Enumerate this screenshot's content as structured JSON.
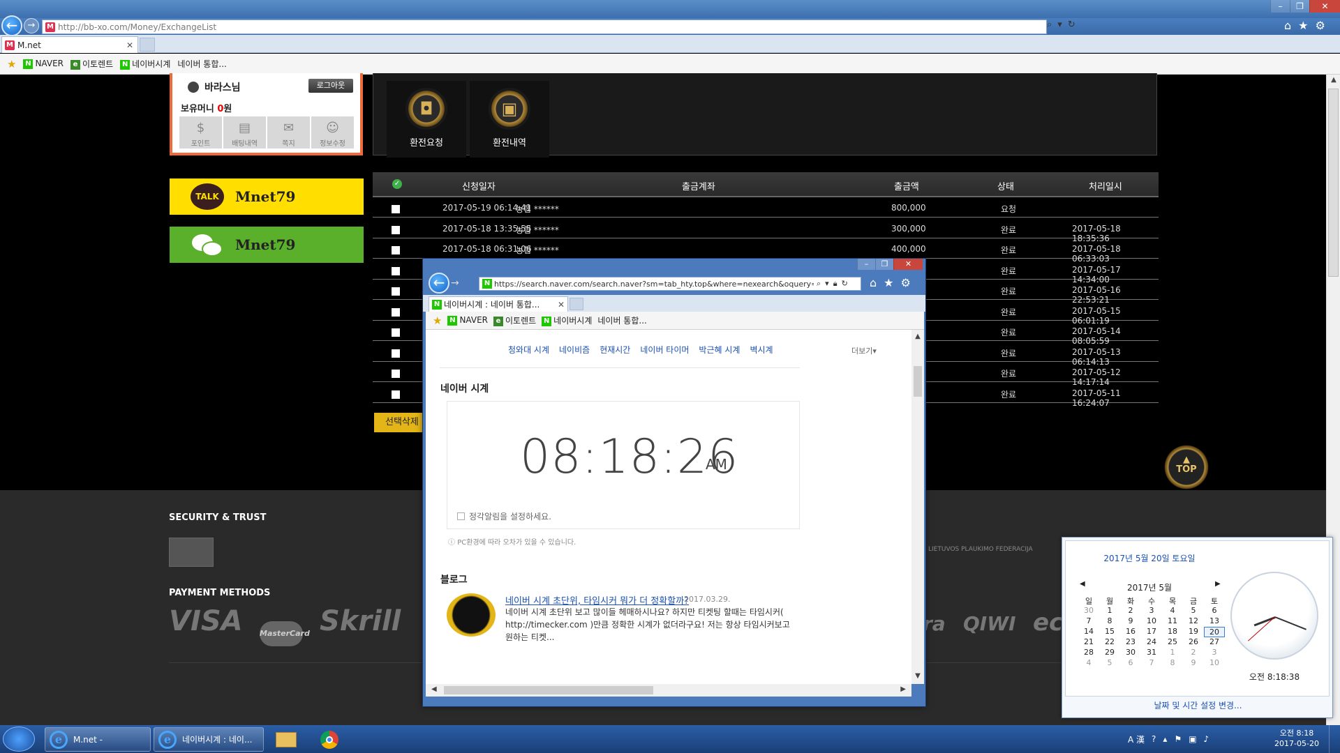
{
  "main_window": {
    "url": "http://bb-xo.com/Money/ExchangeList",
    "tab_title": "M.net",
    "favicon_letter": "M"
  },
  "favorites": [
    "NAVER",
    "이토렌트",
    "네이버시계",
    "네이버 통합..."
  ],
  "site": {
    "user_name": "바라스님",
    "logout_label": "로그아웃",
    "money_label": "보유머니",
    "money_value": "0",
    "money_unit": "원",
    "user_menu": [
      {
        "label": "포인트",
        "icon": "coin-icon"
      },
      {
        "label": "배팅내역",
        "icon": "document-icon"
      },
      {
        "label": "쪽지",
        "icon": "mail-icon"
      },
      {
        "label": "정보수정",
        "icon": "person-icon"
      }
    ],
    "exchange_buttons": [
      {
        "label": "환전요청",
        "icon": "wallet-coin-icon"
      },
      {
        "label": "환전내역",
        "icon": "cash-coin-icon"
      }
    ],
    "kakao_id": "Mnet79",
    "kakao_badge": "TALK",
    "wechat_id": "Mnet79",
    "table_headers": [
      "신청일자",
      "출금계좌",
      "출금액",
      "상태",
      "처리일시"
    ],
    "rows": [
      {
        "date": "2017-05-19 06:14:41",
        "account": "농협 ******",
        "amount": "800,000",
        "status": "요청",
        "processed": ""
      },
      {
        "date": "2017-05-18 13:35:55",
        "account": "농협 ******",
        "amount": "300,000",
        "status": "완료",
        "processed": "2017-05-18 18:35:36"
      },
      {
        "date": "2017-05-18 06:31:06",
        "account": "농협 ******",
        "amount": "400,000",
        "status": "완료",
        "processed": "2017-05-18 06:33:03"
      },
      {
        "date": "",
        "account": "",
        "amount": "",
        "status": "완료",
        "processed": "2017-05-17 14:34:00"
      },
      {
        "date": "",
        "account": "",
        "amount": "",
        "status": "완료",
        "processed": "2017-05-16 22:53:21"
      },
      {
        "date": "",
        "account": "",
        "amount": "",
        "status": "완료",
        "processed": "2017-05-15 06:01:19"
      },
      {
        "date": "",
        "account": "",
        "amount": "",
        "status": "완료",
        "processed": "2017-05-14 08:05:59"
      },
      {
        "date": "",
        "account": "",
        "amount": "",
        "status": "완료",
        "processed": "2017-05-13 06:14:13"
      },
      {
        "date": "",
        "account": "",
        "amount": "",
        "status": "완료",
        "processed": "2017-05-12 14:17:14"
      },
      {
        "date": "",
        "account": "",
        "amount": "",
        "status": "완료",
        "processed": "2017-05-11 16:24:07"
      }
    ],
    "delete_label": "선택삭제",
    "top_label": "TOP",
    "footer_security": "SECURITY & TRUST",
    "footer_payment": "PAYMENT METHODS",
    "payment_logos": [
      "VISA",
      "MasterCard",
      "Skrill",
      "ra",
      "QIWI",
      "ec"
    ],
    "sponsor_text": "LIETUVOS PLAUKIMO FEDERACIJA"
  },
  "popup": {
    "url": "https://search.naver.com/search.naver?sm=tab_hty.top&where=nexearch&oquery=%",
    "tab_title": "네이버시계 : 네이버 통합...",
    "related_links": [
      "청와대 시계",
      "네이비즘",
      "현재시간",
      "네이버 타이머",
      "박근혜 시계",
      "벽시계"
    ],
    "more_label": "더보기",
    "clock_section_title": "네이버 시계",
    "clock_time": "08:18:26",
    "clock_ampm": "AM",
    "alarm_label": "정각알림을 설정하세요.",
    "note": "PC환경에 따라 오차가 있을 수 있습니다.",
    "blog_section_title": "블로그",
    "blog_title": "네이버 시계 초단위, 타임시커 뭐가 더 정확할까?",
    "blog_date": "2017.03.29.",
    "blog_body": "네이버 시계 초단위 보고 많이들 헤매하시나요? 하지만 티켓팅 할때는 타임시커( http://timecker.com )만큼 정확한 시계가 없더라구요! 저는 항상 타임시커보고 원하는 티켓..."
  },
  "calendar": {
    "header": "2017년 5월 20일 토요일",
    "month": "2017년 5월",
    "weekdays": [
      "일",
      "월",
      "화",
      "수",
      "목",
      "금",
      "토"
    ],
    "weeks": [
      [
        "30",
        "1",
        "2",
        "3",
        "4",
        "5",
        "6"
      ],
      [
        "7",
        "8",
        "9",
        "10",
        "11",
        "12",
        "13"
      ],
      [
        "14",
        "15",
        "16",
        "17",
        "18",
        "19",
        "20"
      ],
      [
        "21",
        "22",
        "23",
        "24",
        "25",
        "26",
        "27"
      ],
      [
        "28",
        "29",
        "30",
        "31",
        "1",
        "2",
        "3"
      ],
      [
        "4",
        "5",
        "6",
        "7",
        "8",
        "9",
        "10"
      ]
    ],
    "today": "20",
    "time": "오전 8:18:38",
    "analog_time": {
      "hour": 8,
      "minute": 18,
      "second": 38
    },
    "change_link": "날짜 및 시간 설정 변경..."
  },
  "taskbar": {
    "items": [
      "M.net -",
      "네이버시계 : 네이..."
    ],
    "ime": "A 漢",
    "clock_time": "오전 8:18",
    "clock_date": "2017-05-20"
  }
}
